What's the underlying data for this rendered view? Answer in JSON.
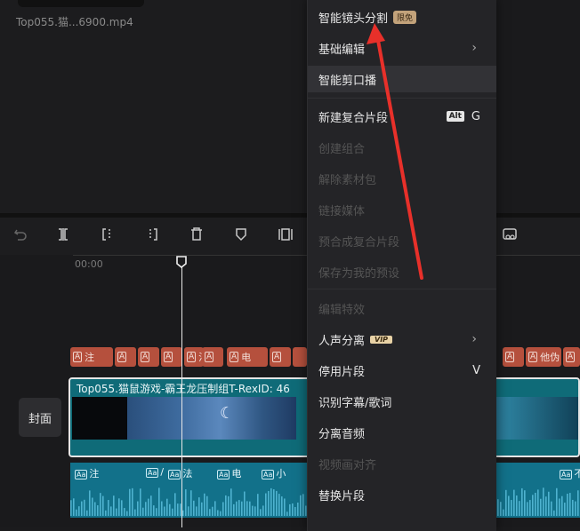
{
  "media": {
    "filename": "Top055.猫...6900.mp4"
  },
  "timeline": {
    "timecode": "00:00",
    "cover_label": "封面",
    "video_clip_title": "Top055.猫鼠游戏-霸王龙压制组T-RexID:  46"
  },
  "sticker_clips": [
    {
      "text": "注"
    },
    {
      "text": ""
    },
    {
      "text": ""
    },
    {
      "text": ""
    },
    {
      "text": "法"
    },
    {
      "text": ""
    },
    {
      "text": "电"
    },
    {
      "text": ""
    },
    {
      "text": ""
    },
    {
      "text": ""
    },
    {
      "text": ""
    },
    {
      "text": ""
    },
    {
      "text": ""
    },
    {
      "text": "他伪"
    },
    {
      "text": ""
    }
  ],
  "audio_clips": [
    {
      "text": "注"
    },
    {
      "text": "/"
    },
    {
      "text": "法"
    },
    {
      "text": "电"
    },
    {
      "text": "小"
    },
    {
      "text": "不"
    }
  ],
  "context_menu": {
    "items": [
      {
        "label": "智能镜头分割",
        "badge": "限免"
      },
      {
        "label": "基础编辑"
      },
      {
        "label": "智能剪口播"
      },
      {
        "label": "新建复合片段",
        "shortcut_mod": "Alt",
        "shortcut_key": "G"
      },
      {
        "label": "创建组合"
      },
      {
        "label": "解除素材包"
      },
      {
        "label": "链接媒体"
      },
      {
        "label": "预合成复合片段"
      },
      {
        "label": "保存为我的预设"
      },
      {
        "label": "编辑特效"
      },
      {
        "label": "人声分离",
        "badge": "VIP"
      },
      {
        "label": "停用片段",
        "shortcut_key": "V"
      },
      {
        "label": "识别字幕/歌词"
      },
      {
        "label": "分离音频"
      },
      {
        "label": "视频画对齐"
      },
      {
        "label": "替换片段"
      }
    ]
  },
  "colors": {
    "accent_arrow": "#e8302a",
    "sticker_clip": "#b5503d",
    "video_clip": "#0f6b78",
    "audio_clip": "#12718a"
  }
}
